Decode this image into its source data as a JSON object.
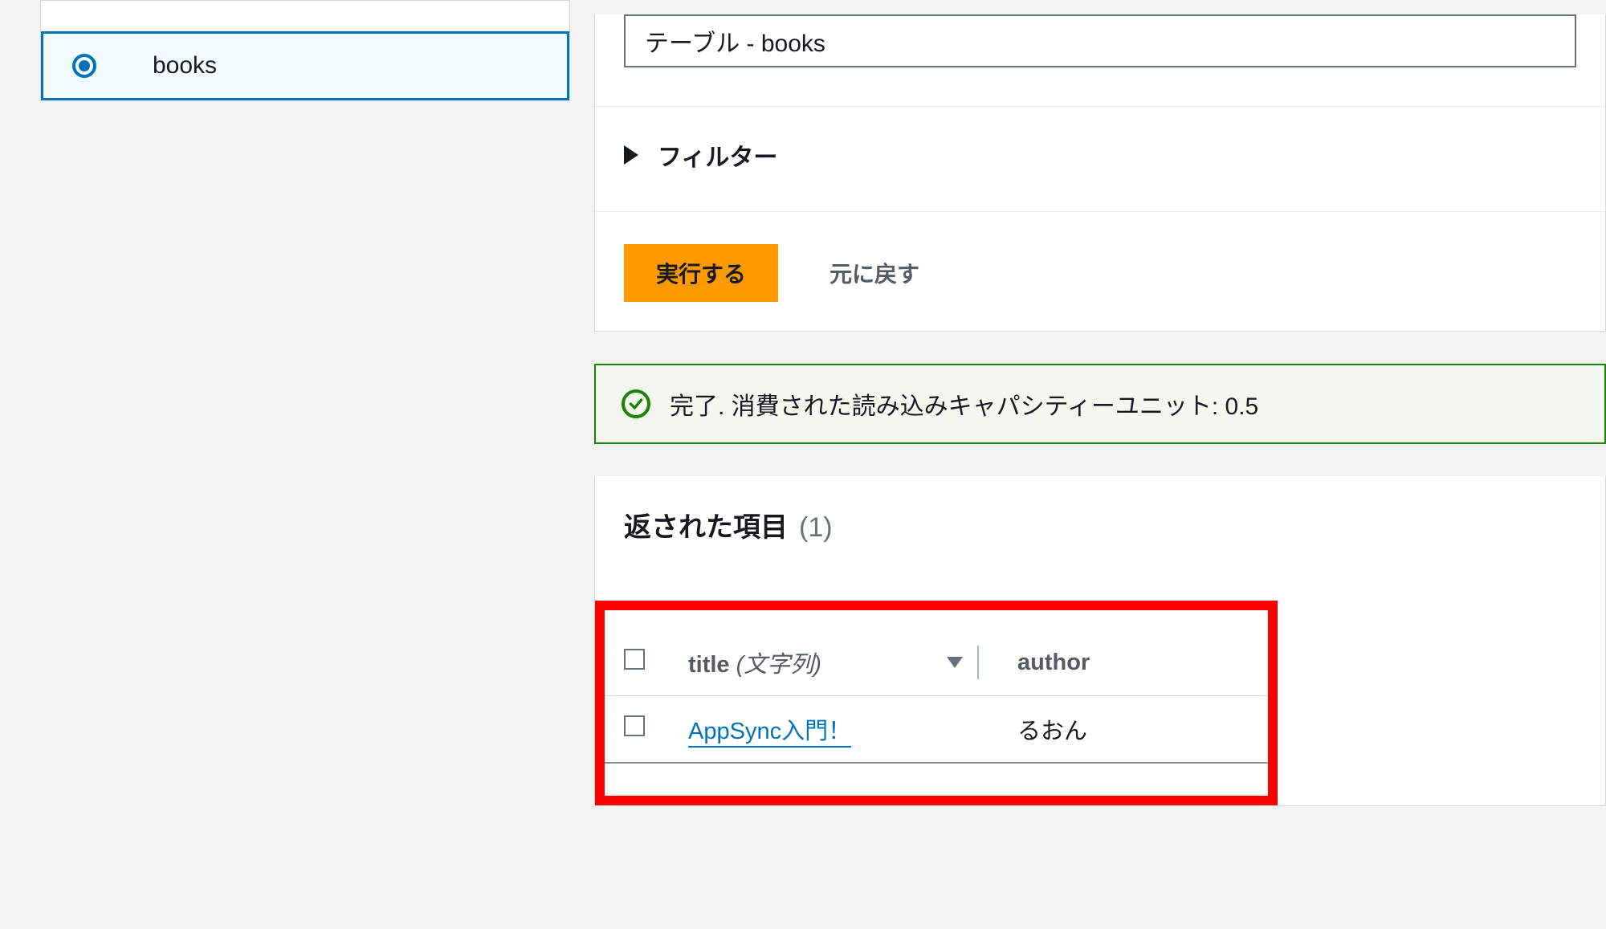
{
  "sidebar": {
    "items": [
      {
        "label": "books",
        "selected": true
      }
    ]
  },
  "query": {
    "table_select_label": "テーブル - books",
    "filter_label": "フィルター",
    "run_button": "実行する",
    "reset_button": "元に戻す"
  },
  "flash": {
    "message": "完了. 消費された読み込みキャパシティーユニット: 0.5"
  },
  "results": {
    "title": "返された項目",
    "count_display": "(1)",
    "columns": {
      "title_label": "title",
      "title_type": "(文字列)",
      "author_label": "author"
    },
    "rows": [
      {
        "title": "AppSync入門！",
        "author": "るおん"
      }
    ]
  }
}
